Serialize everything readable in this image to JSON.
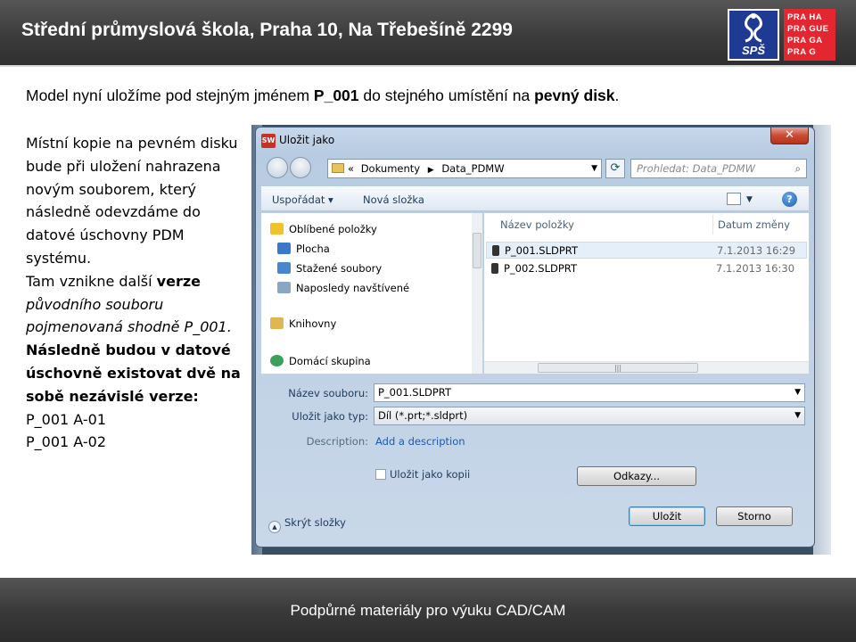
{
  "header": {
    "title": "Střední průmyslová škola, Praha 10, Na Třebešíně 2299",
    "sps_logo_text": "SPŠ",
    "prague_logo_lines": [
      "PRA HA",
      "PRA GUE",
      "PRA GA",
      "PRA G"
    ]
  },
  "intro": {
    "part1": "Model nyní uložíme pod stejným jménem ",
    "bold1": "P_001",
    "part2": " do stejného umístění na ",
    "bold2": "pevný disk",
    "part3": "."
  },
  "left_text": {
    "p1": "Místní kopie na pevném disku bude při uložení nahrazena novým souborem, který následně odevzdáme do datové úschovny PDM systému.",
    "p2_a": "Tam vznikne další ",
    "p2_bold": "verze",
    "p2_italic": " původního souboru pojmenovaná shodně P_001.",
    "p3": "Následně budou v datové úschovně existovat  dvě na sobě nezávislé verze:",
    "v1": "P_001 A-01",
    "v2": "P_001 A-02"
  },
  "dialog": {
    "title": "Uložit jako",
    "app_icon_text": "SW",
    "close_glyph": "✕",
    "address": {
      "prefix": "«",
      "crumb1": "Dokumenty",
      "crumb2": "Data_PDMW"
    },
    "search_placeholder": "Prohledat: Data_PDMW",
    "toolbar": {
      "organize": "Uspořádat ▾",
      "new_folder": "Nová složka"
    },
    "nav": {
      "favorites": "Oblíbené položky",
      "desktop": "Plocha",
      "downloads": "Stažené soubory",
      "recent": "Naposledy navštívené",
      "libraries": "Knihovny",
      "homegroup": "Domácí skupina"
    },
    "columns": {
      "name": "Název položky",
      "date": "Datum změny"
    },
    "files": [
      {
        "name": "P_001.SLDPRT",
        "date": "7.1.2013 16:29"
      },
      {
        "name": "P_002.SLDPRT",
        "date": "7.1.2013 16:30"
      }
    ],
    "form": {
      "filename_label": "Název souboru:",
      "filename_value": "P_001.SLDPRT",
      "type_label": "Uložit jako typ:",
      "type_value": "Díl (*.prt;*.sldprt)",
      "description_label": "Description:",
      "description_link": "Add a description",
      "save_copy_label": "Uložit jako kopii",
      "references_button": "Odkazy...",
      "save_button": "Uložit",
      "cancel_button": "Storno",
      "hide_folders": "Skrýt složky"
    }
  },
  "footer": {
    "text": "Podpůrné materiály pro výuku CAD/CAM"
  }
}
